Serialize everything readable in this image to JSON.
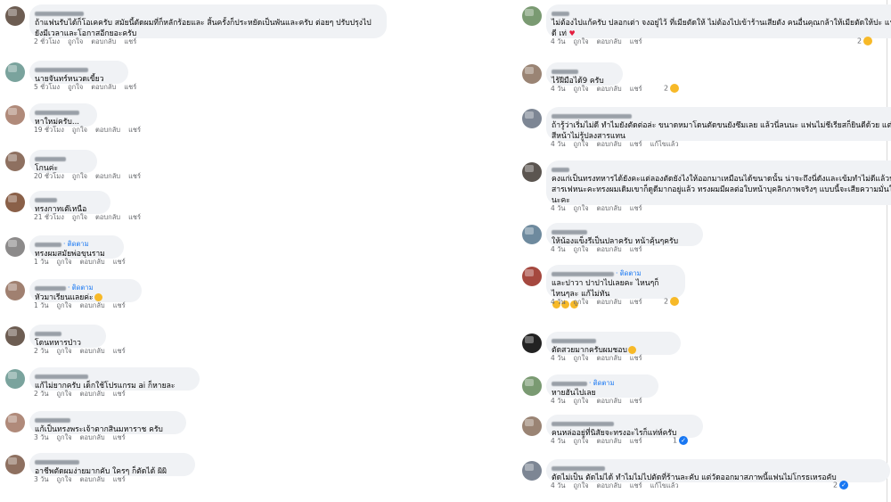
{
  "colors": {
    "bubble": "#f0f2f5",
    "link": "#1877f2",
    "meta": "#65676b",
    "reaction": "#f7b928"
  },
  "labels": {
    "like": "ถูกใจ",
    "reply": "ตอบกลับ",
    "share": "แชร์",
    "follow": "ติดตาม",
    "edited": "แก้ไขแล้ว"
  },
  "left": [
    {
      "text": "ถ้าแฟนรับได้ก็โอเคครับ สมัยนี้ตัดผมที่ก็หลักร้อยและ สิ้นครั้งก็ประหยัดเป็นพันและครับ ต่อยๆ ปรับปรุงไปยังมีเวลาและโอกาสอีกยอะครับ",
      "time": "2 ชั่วโมง",
      "follow": false,
      "edited": false
    },
    {
      "text": "นายจันทร์หนวดเขี้ยว",
      "time": "5 ชั่วโมง",
      "follow": false,
      "edited": false
    },
    {
      "text": "หาใหม่ครับ...",
      "time": "19 ชั่วโมง",
      "follow": false,
      "edited": false
    },
    {
      "text": "โกนค่ะ",
      "time": "20 ชั่วโมง",
      "follow": false,
      "edited": false
    },
    {
      "text": "ทรงกาทเต๊เหนือ",
      "time": "21 ชั่วโมง",
      "follow": false,
      "edited": false
    },
    {
      "text": "ทรงผมสมัยพ่อขุนราม",
      "time": "1 วัน",
      "follow": true,
      "edited": false
    },
    {
      "text": "หัวมาเรียนแลยค่ะ",
      "time": "1 วัน",
      "follow": true,
      "edited": false,
      "emoji": true
    },
    {
      "text": "โดนทหารป่าว",
      "time": "2 วัน",
      "follow": false,
      "edited": false
    },
    {
      "text": "แก้ไม่ยากครับ เด็กใช้โปรแกรม ai ก็หายละ",
      "time": "2 วัน",
      "follow": false,
      "edited": false
    },
    {
      "text": "แก้เป็นทรงพระเจ้าตากสินมหาราช ครับ",
      "time": "3 วัน",
      "follow": false,
      "edited": false
    },
    {
      "text": "อาชีพตัดผมง่ายมากคับ ใครๆ ก็ตัดได้ ผิผิ",
      "time": "3 วัน",
      "follow": false,
      "edited": false
    }
  ],
  "right": [
    {
      "text": "ไม่ต้องไปแก้ครับ ปลอกเต่า จงอยู่ไว้ ที่เมียตัดให้ ไม่ต้องไปเข้าร้านเสียตัง คนอื่นคุณกล้าให้เมียตัดให้ปะ แฟชั่นดี เท่",
      "time": "4 วัน",
      "follow": false,
      "edited": false,
      "heart": true,
      "reactCount": "2"
    },
    {
      "text": "ไร้ฝีมือได้9 ครับ",
      "time": "4 วัน",
      "follow": false,
      "edited": false,
      "reactCount": "2"
    },
    {
      "text": "ถ้ารู้ว่าเริ่มไม่ดี ทำไมยังตัดต่อล่ะ ขนาดหมาโดนตัดขนยังซึมเลย แล้วนี่ลนนะ แฟนไม่ชีเรียสก็ยินดีด้วย แต่จากสีหน้าไม่รู้ปลงสารแทน",
      "time": "4 วัน",
      "follow": false,
      "edited": true
    },
    {
      "text": "คงแก่เป็นทรงทหารได้ยังคะแต่ลองตัดยังไงให้ออกมาเหมือนได้ขนาดนั้น น่าจะถึงนี่ดังและเข้มทำไม่ดีแล้วน่าสงสารเฟหนะคะทรงผมเดิมเขาก็ดูดีมากอยู่แล้ว ทรงผมมีผลต่อใบหน้าบุคลิกภาพจริงๆ แบบนี้จะเสียความมั่นใจได้นะคะ",
      "time": "4 วัน",
      "follow": false,
      "edited": false
    },
    {
      "text": "ให้น้องแข็งรีเป็นปลาครับ หน้าคุ้นๆครับ",
      "time": "4 วัน",
      "follow": false,
      "edited": false
    },
    {
      "text": "และปาวา ปาปาไปเลยคะ ไหนๆก็ไหนๆละ แก้ไม่ทัน",
      "time": "4 วัน",
      "follow": true,
      "edited": false,
      "emojiLine": true,
      "reactCount": "2"
    },
    {
      "text": "ตัดสวยมากครับผมชอบ",
      "time": "4 วัน",
      "follow": false,
      "edited": false,
      "emoji": true
    },
    {
      "text": "หายฮันไปเลย",
      "time": "4 วัน",
      "follow": true,
      "edited": false
    },
    {
      "text": "คนหล่ออยู่ที่นิสัยจะทรงอะไรก็แท่ห์ครับ",
      "time": "4 วัน",
      "follow": false,
      "edited": false,
      "reactCount": "1",
      "like": true
    },
    {
      "text": "ตัดไม่เป็น ตัดไม่ได้ ทำไมไม่ไปตัดที่ร้านละคับ แต่วัดออกมาสภาพนี้แฟนไม่โกรธเหรอคับ",
      "time": "4 วัน",
      "follow": false,
      "edited": true,
      "reactCount": "2",
      "like": true
    }
  ]
}
